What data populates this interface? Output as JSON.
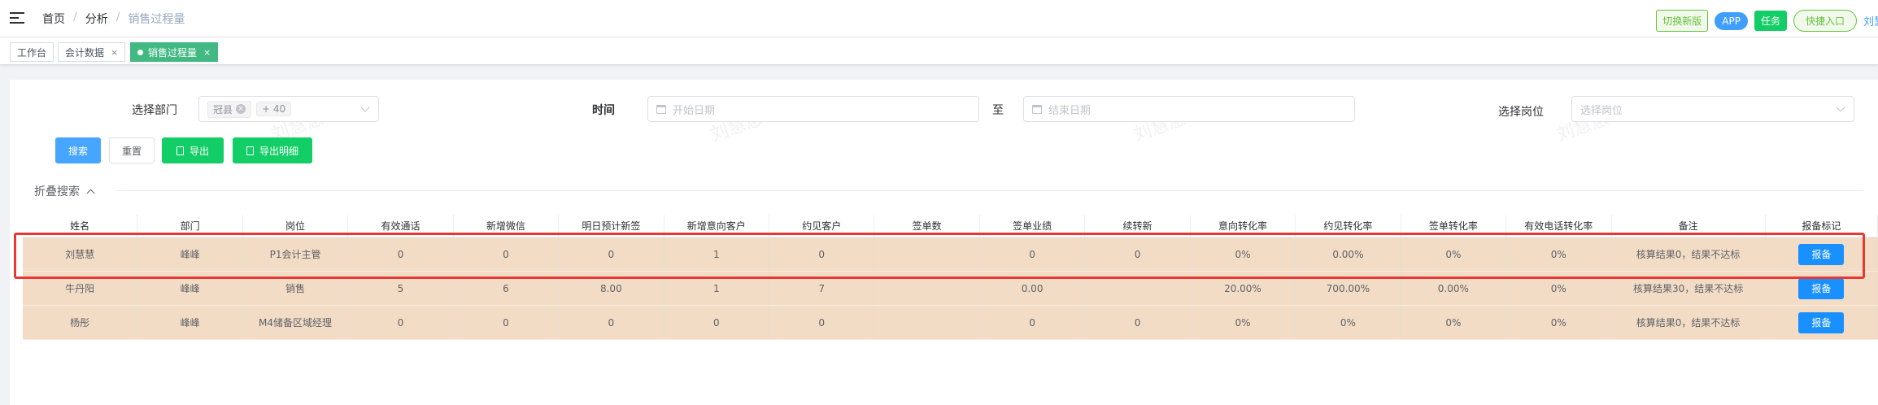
{
  "topbar": {
    "breadcrumb": [
      "首页",
      "分析",
      "销售过程量"
    ],
    "separator": "/",
    "switch_label": "切换新版",
    "app_label": "APP",
    "task_label": "任务",
    "quick_label": "快捷入口",
    "user": "刘慧慧"
  },
  "tabs": [
    {
      "label": "工作台"
    },
    {
      "label": "会计数据",
      "close": "×"
    },
    {
      "label": "销售过程量",
      "close": "×",
      "active": true
    }
  ],
  "filters": {
    "dept_label": "选择部门",
    "dept_tag": "冠县",
    "dept_more": "+ 40",
    "time_label": "时间",
    "start_placeholder": "开始日期",
    "to_label": "至",
    "end_placeholder": "结束日期",
    "post_label": "选择岗位",
    "post_placeholder": "选择岗位"
  },
  "actions": {
    "search": "搜索",
    "reset": "重置",
    "export": "导出",
    "export_detail": "导出明细"
  },
  "fold_label": "折叠搜索",
  "watermark": "刘慧慧",
  "table": {
    "columns": [
      "姓名",
      "部门",
      "岗位",
      "有效通话",
      "新增微信",
      "明日预计新签",
      "新增意向客户",
      "约见客户",
      "签单数",
      "签单业绩",
      "续转新",
      "意向转化率",
      "约见转化率",
      "签单转化率",
      "有效电话转化率",
      "备注",
      "报备标记"
    ],
    "rows": [
      [
        "刘慧慧",
        "峰峰",
        "P1会计主管",
        "0",
        "0",
        "0",
        "1",
        "0",
        "",
        "0",
        "0",
        "0%",
        "0.00%",
        "0%",
        "0%",
        "核算结果0，结果不达标",
        "报备"
      ],
      [
        "牛丹阳",
        "峰峰",
        "销售",
        "5",
        "6",
        "8.00",
        "1",
        "7",
        "",
        "0.00",
        "",
        "20.00%",
        "700.00%",
        "0.00%",
        "0%",
        "核算结果30，结果不达标",
        "报备"
      ],
      [
        "杨彤",
        "峰峰",
        "M4储备区域经理",
        "0",
        "0",
        "0",
        "0",
        "0",
        "",
        "0",
        "0",
        "0%",
        "0%",
        "0%",
        "0%",
        "核算结果0，结果不达标",
        "报备"
      ]
    ]
  }
}
